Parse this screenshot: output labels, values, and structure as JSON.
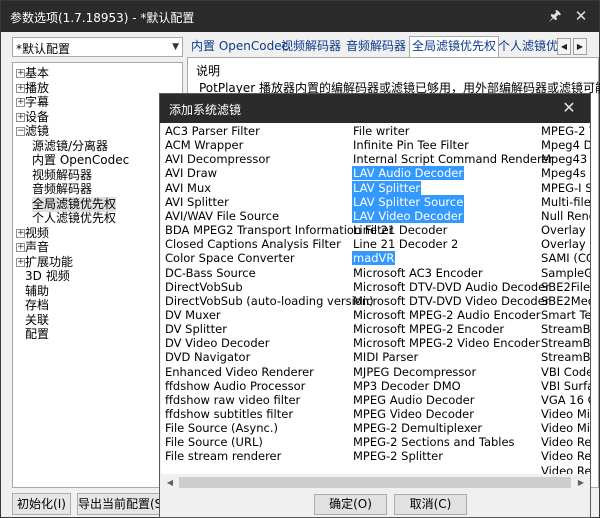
{
  "window": {
    "title": "参数选项(1.7.18953) - *默认配置"
  },
  "profile": {
    "selected": "*默认配置"
  },
  "tree": [
    {
      "label": "基本",
      "expander": "+"
    },
    {
      "label": "播放",
      "expander": "+"
    },
    {
      "label": "字幕",
      "expander": "+"
    },
    {
      "label": "设备",
      "expander": "+"
    },
    {
      "label": "滤镜",
      "expander": "−"
    },
    {
      "label": "源滤镜/分离器"
    },
    {
      "label": "内置 OpenCodec"
    },
    {
      "label": "视频解码器"
    },
    {
      "label": "音频解码器"
    },
    {
      "label": "全局滤镜优先权",
      "selected": true
    },
    {
      "label": "个人滤镜优先权"
    },
    {
      "label": "视频",
      "expander": "+"
    },
    {
      "label": "声音",
      "expander": "+"
    },
    {
      "label": "扩展功能",
      "expander": "+"
    },
    {
      "label": "3D 视频"
    },
    {
      "label": "辅助"
    },
    {
      "label": "存档"
    },
    {
      "label": "关联"
    },
    {
      "label": "配置"
    }
  ],
  "tabs": [
    {
      "label": "内置 OpenCodec"
    },
    {
      "label": "视频解码器"
    },
    {
      "label": "音频解码器"
    },
    {
      "label": "全局滤镜优先权",
      "active": true
    },
    {
      "label": "个人滤镜优先"
    }
  ],
  "panel": {
    "legend": "说明",
    "description": "PotPlayer 播放器内置的编解码器或滤镜已够用，用外部编解码器或滤镜可能会"
  },
  "buttons": {
    "init": "初始化(I)",
    "export": "导出当前配置(S)"
  },
  "dialog": {
    "title": "添加系统滤镜",
    "ok": "确定(O)",
    "cancel": "取消(C)",
    "columns": [
      [
        "AC3 Parser Filter",
        "ACM Wrapper",
        "AVI Decompressor",
        "AVI Draw",
        "AVI Mux",
        "AVI Splitter",
        "AVI/WAV File Source",
        "BDA MPEG2 Transport Information Filter",
        "Closed Captions Analysis Filter",
        "Color Space Converter",
        "DC-Bass Source",
        "DirectVobSub",
        "DirectVobSub (auto-loading version)",
        "DV Muxer",
        "DV Splitter",
        "DV Video Decoder",
        "DVD Navigator",
        "Enhanced Video Renderer",
        "ffdshow Audio Processor",
        "ffdshow raw video filter",
        "ffdshow subtitles filter",
        "File Source (Async.)",
        "File Source (URL)",
        "File stream renderer"
      ],
      [
        "File writer",
        "Infinite Pin Tee Filter",
        "Internal Script Command Renderer",
        "LAV Audio Decoder",
        "LAV Splitter",
        "LAV Splitter Source",
        "LAV Video Decoder",
        "Line 21 Decoder",
        "Line 21 Decoder 2",
        "madVR",
        "Microsoft AC3 Encoder",
        "Microsoft DTV-DVD Audio Decoder",
        "Microsoft DTV-DVD Video Decoder",
        "Microsoft MPEG-2 Audio Encoder",
        "Microsoft MPEG-2 Encoder",
        "Microsoft MPEG-2 Video Encoder",
        "MIDI Parser",
        "MJPEG Decompressor",
        "MP3 Decoder DMO",
        "MPEG Audio Decoder",
        "MPEG Video Decoder",
        "MPEG-2 Demultiplexer",
        "MPEG-2 Sections and Tables",
        "MPEG-2 Splitter"
      ],
      [
        "MPEG-2 V",
        "Mpeg4 De",
        "Mpeg43 D",
        "Mpeg4s D",
        "MPEG-I St",
        "Multi-file",
        "Null Rende",
        "Overlay M",
        "Overlay M",
        "SAMI (CC)",
        "SampleGra",
        "SBE2FileS",
        "SBE2Medi",
        "Smart Tee",
        "StreamBuf",
        "StreamBuf",
        "StreamBuf",
        "VBI Codec",
        "VBI Surfac",
        "VGA 16 C",
        "Video Mix",
        "Video Mix",
        "Video Ren",
        "Video Ren",
        "Video Ren"
      ]
    ],
    "selected": [
      "LAV Audio Decoder",
      "LAV Splitter",
      "LAV Splitter Source",
      "LAV Video Decoder",
      "madVR"
    ]
  }
}
